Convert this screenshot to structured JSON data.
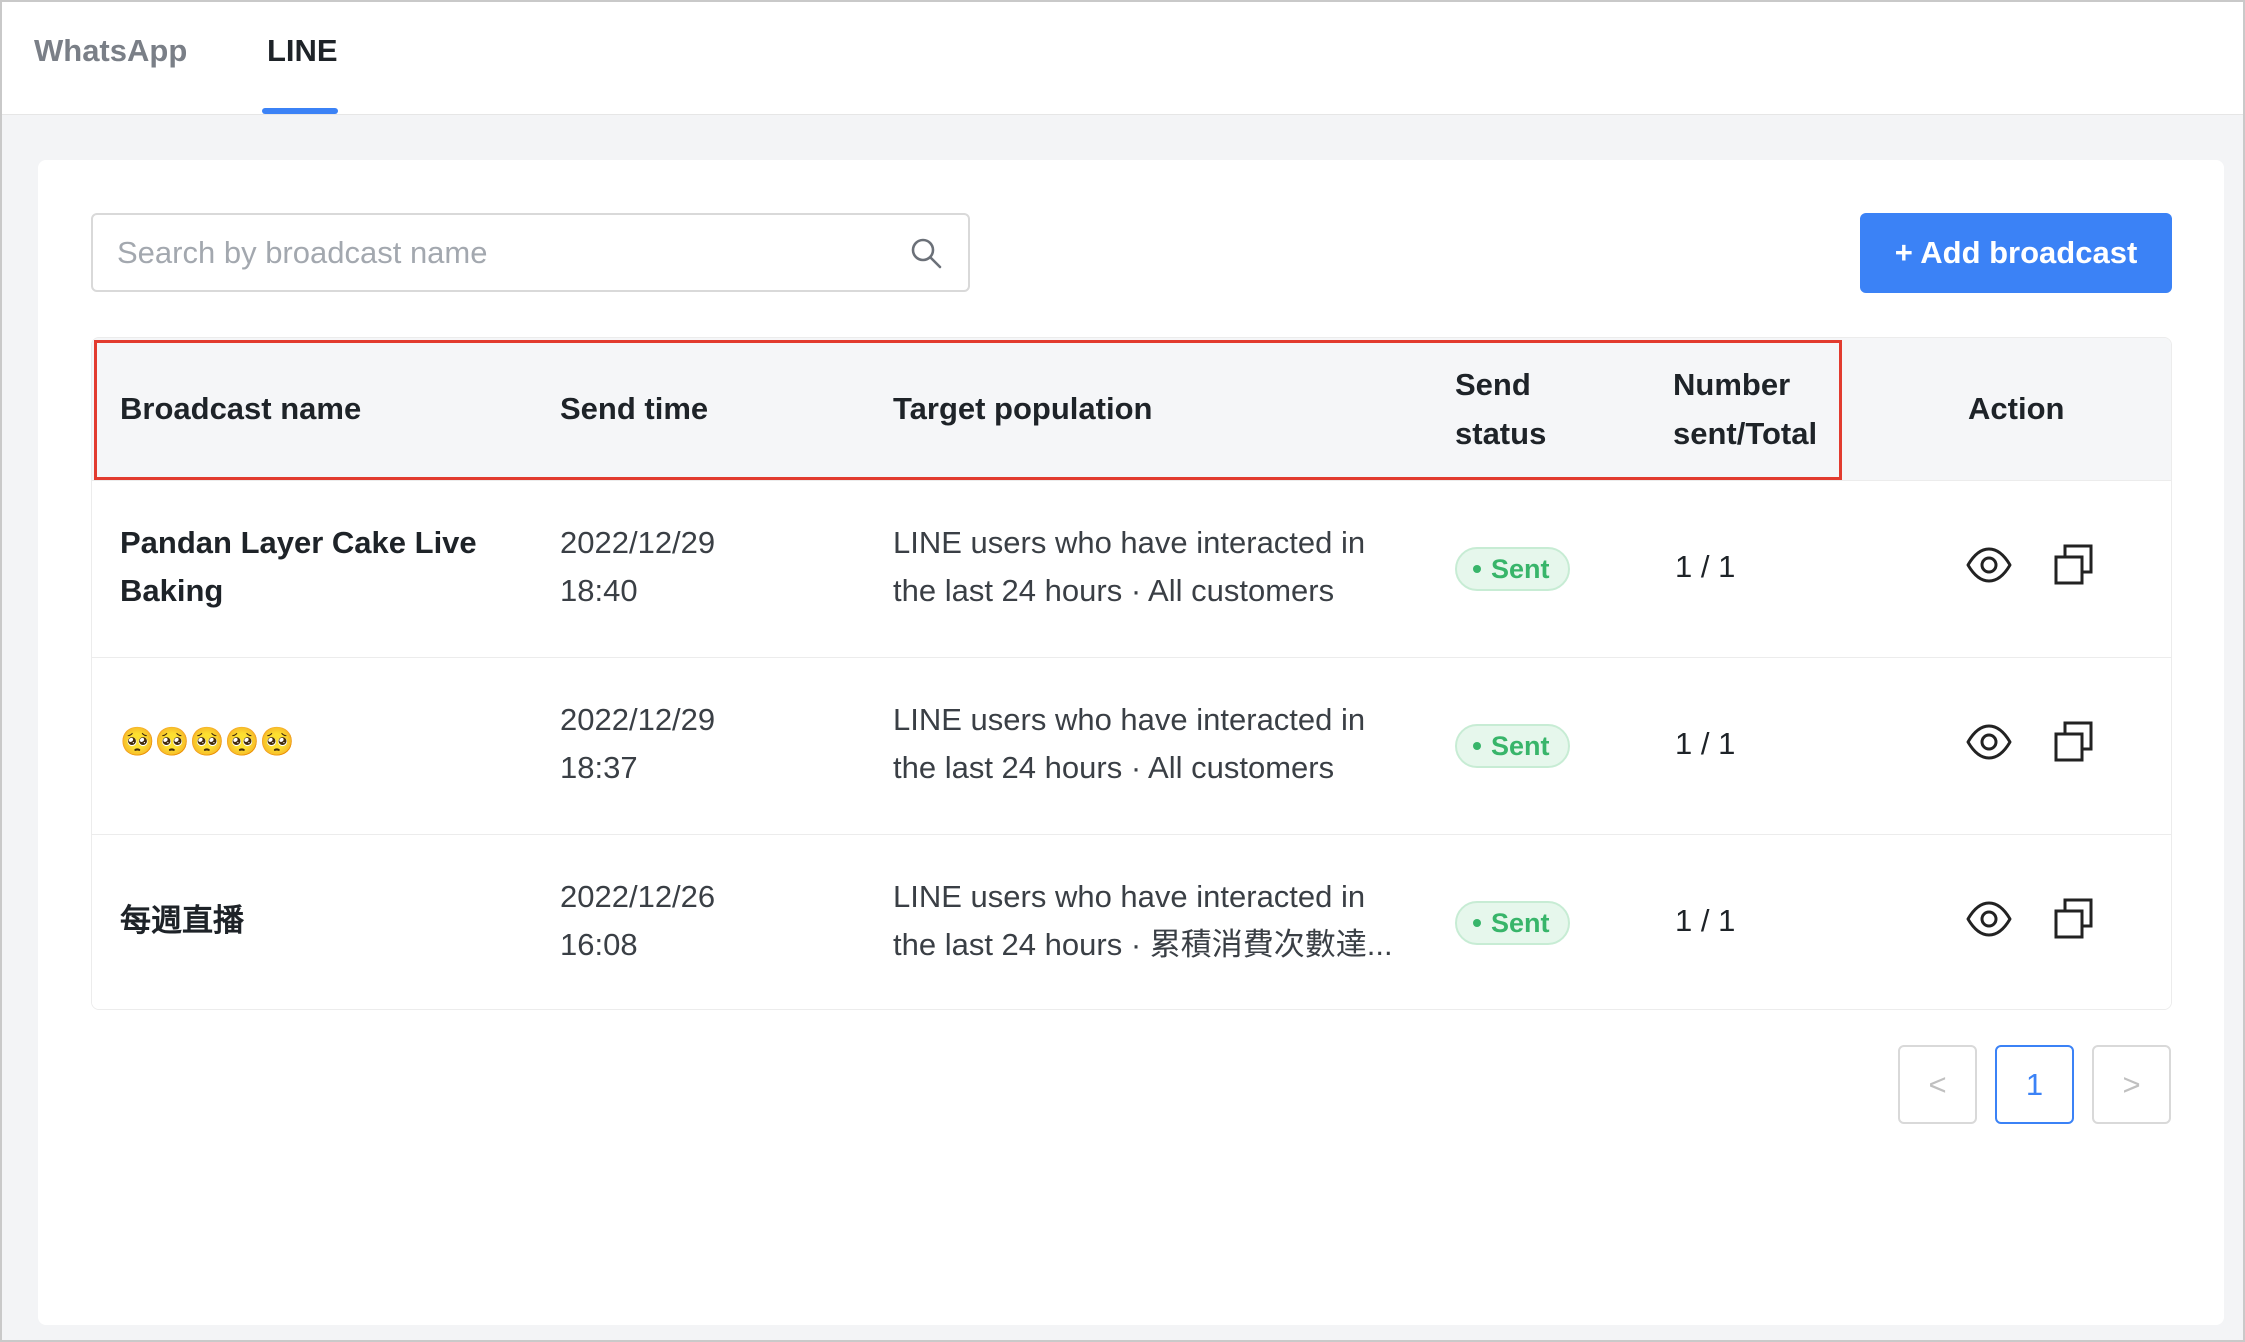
{
  "tabs": [
    {
      "label": "WhatsApp",
      "active": false
    },
    {
      "label": "LINE",
      "active": true
    }
  ],
  "search": {
    "placeholder": "Search by broadcast name",
    "value": ""
  },
  "add_button": {
    "label": "+ Add broadcast"
  },
  "table": {
    "headers": {
      "name": "Broadcast name",
      "send_time": "Send time",
      "target": "Target population",
      "status_line1": "Send",
      "status_line2": "status",
      "count_line1": "Number",
      "count_line2": "sent/Total",
      "action": "Action"
    },
    "rows": [
      {
        "name_line1": "Pandan Layer Cake Live",
        "name_line2": "Baking",
        "date": "2022/12/29",
        "time": "18:40",
        "target_line1": "LINE users who have interacted in",
        "target_line2": "the last 24 hours · All customers",
        "status": "Sent",
        "count": "1 / 1"
      },
      {
        "name_line1": "🥺🥺🥺🥺🥺",
        "name_line2": "",
        "date": "2022/12/29",
        "time": "18:37",
        "target_line1": "LINE users who have interacted in",
        "target_line2": "the last 24 hours · All customers",
        "status": "Sent",
        "count": "1 / 1"
      },
      {
        "name_line1": "每週直播",
        "name_line2": "",
        "date": "2022/12/26",
        "time": "16:08",
        "target_line1": "LINE users who have interacted in",
        "target_line2": "the last 24 hours · 累積消費次數達...",
        "status": "Sent",
        "count": "1 / 1"
      }
    ]
  },
  "pagination": {
    "prev": "<",
    "current": "1",
    "next": ">"
  },
  "colors": {
    "accent": "#3b82f6",
    "status_green": "#38b56a",
    "highlight": "#e23b2f"
  },
  "icons": {
    "search": "search-icon",
    "view": "eye-icon",
    "copy": "copy-icon"
  }
}
